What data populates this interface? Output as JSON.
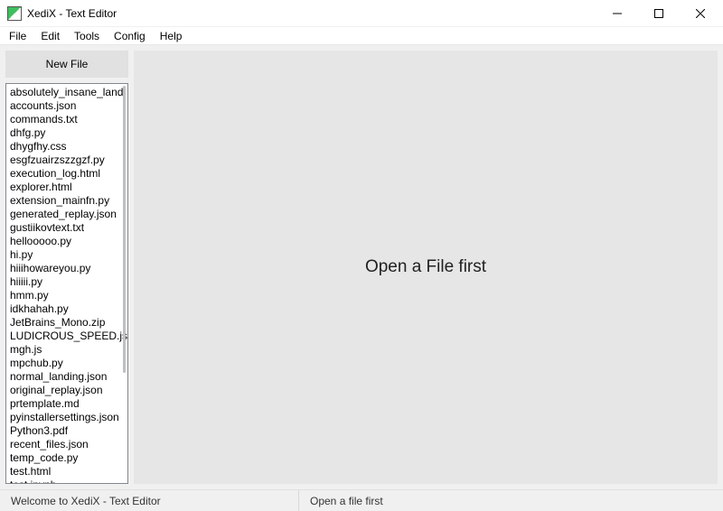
{
  "window": {
    "title": "XediX - Text Editor"
  },
  "menubar": {
    "items": [
      "File",
      "Edit",
      "Tools",
      "Config",
      "Help"
    ]
  },
  "sidebar": {
    "new_file_label": "New File",
    "files": [
      "absolutely_insane_land",
      "accounts.json",
      "commands.txt",
      "dhfg.py",
      "dhygfhy.css",
      "esgfzuairzszzgzf.py",
      "execution_log.html",
      "explorer.html",
      "extension_mainfn.py",
      "generated_replay.json",
      "gustiikovtext.txt",
      "hellooooo.py",
      "hi.py",
      "hiiihowareyou.py",
      "hiiiii.py",
      "hmm.py",
      "idkhahah.py",
      "JetBrains_Mono.zip",
      "LUDICROUS_SPEED.jsc",
      "mgh.js",
      "mpchub.py",
      "normal_landing.json",
      "original_replay.json",
      "prtemplate.md",
      "pyinstallersettings.json",
      "Python3.pdf",
      "recent_files.json",
      "temp_code.py",
      "test.html",
      "test.ipynb"
    ]
  },
  "editor": {
    "placeholder": "Open a File first"
  },
  "statusbar": {
    "left": "Welcome to XediX - Text Editor",
    "right": "Open a file first"
  }
}
